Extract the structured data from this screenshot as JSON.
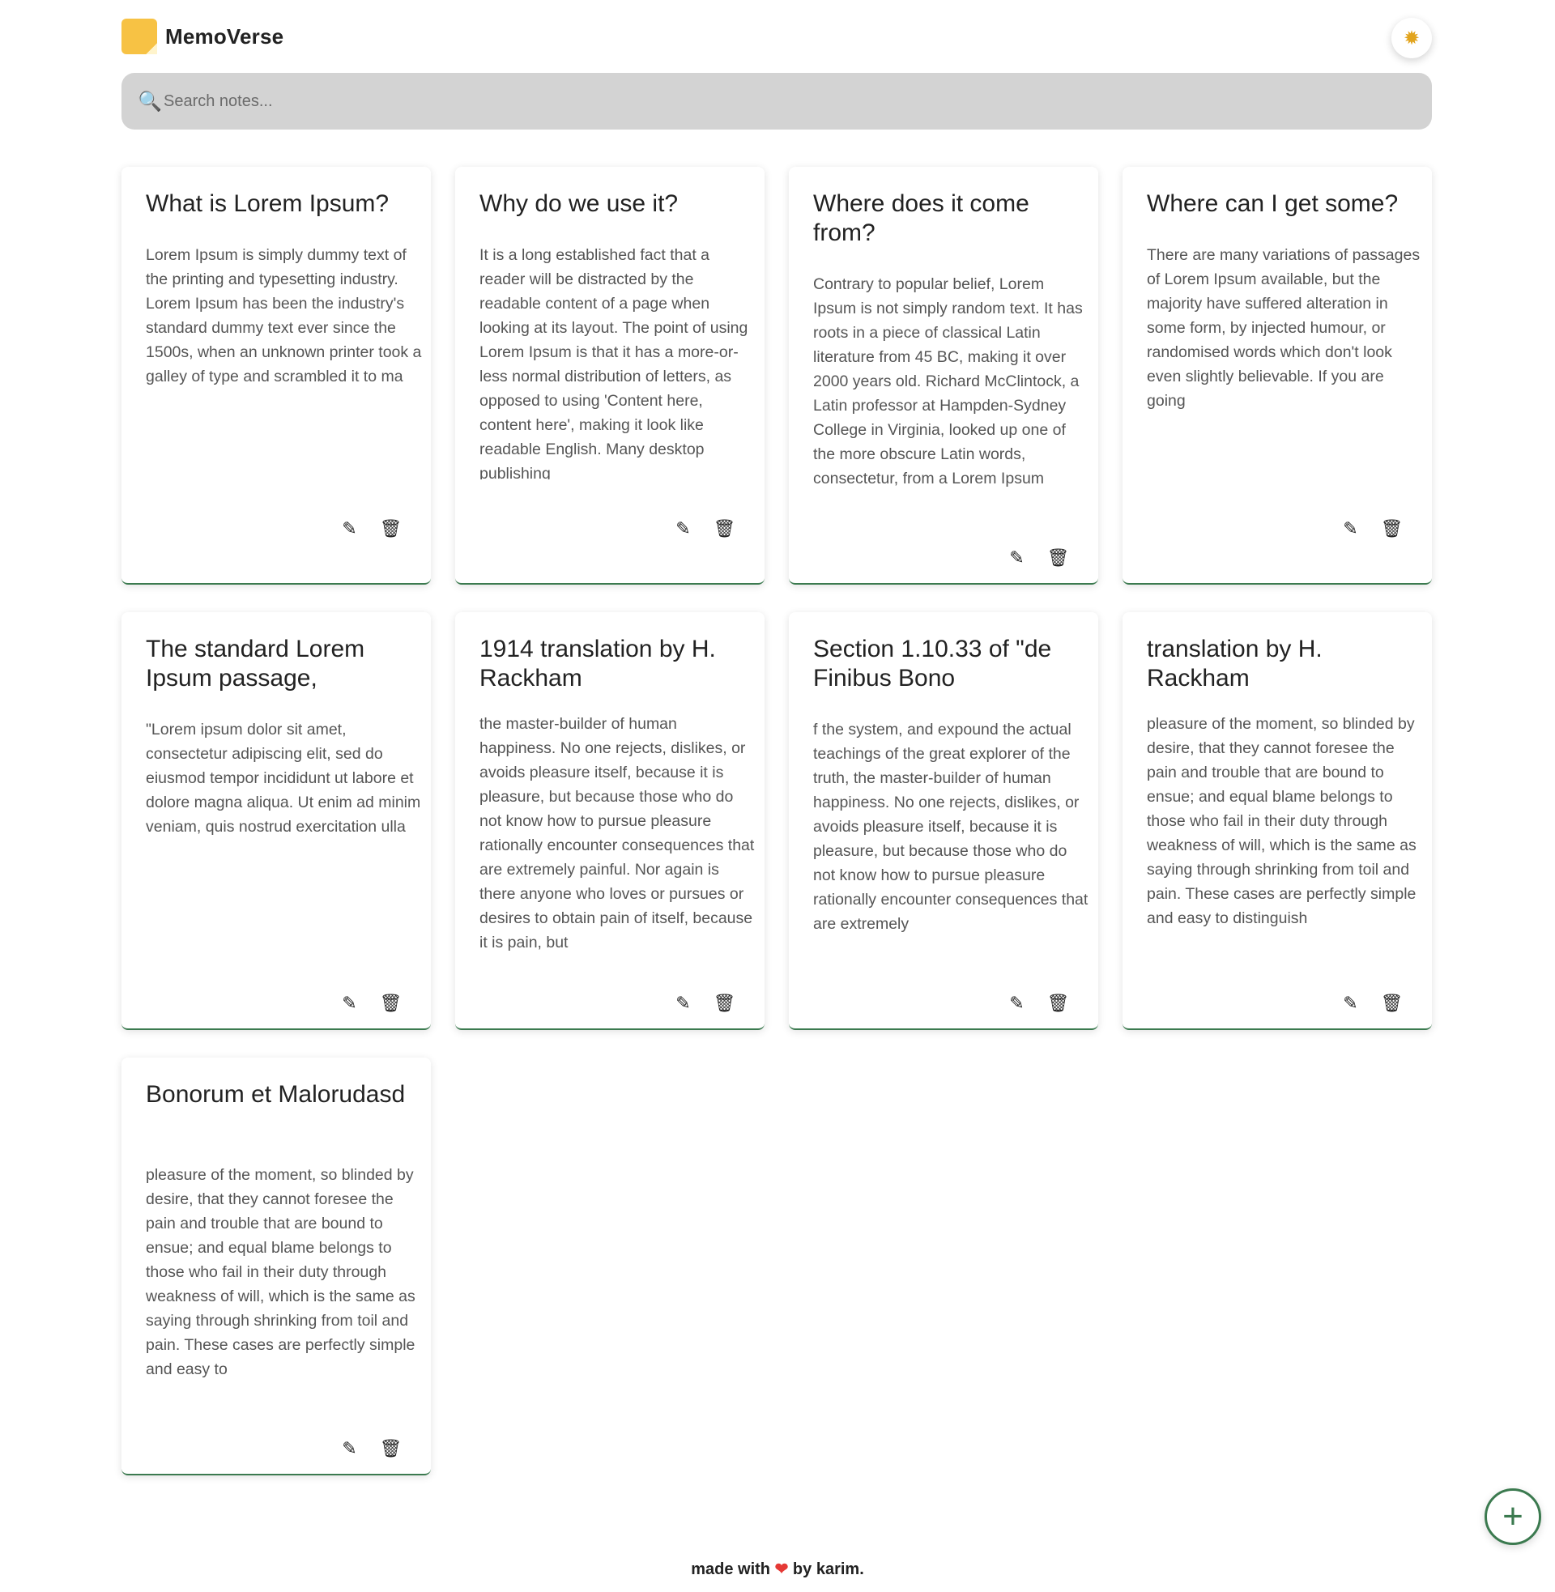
{
  "app": {
    "name": "MemoVerse",
    "theme_toggle_icon": "sun-icon"
  },
  "search": {
    "placeholder": "Search notes...",
    "icon": "search-icon"
  },
  "notes": [
    {
      "title": "What is Lorem Ipsum?",
      "body": "Lorem Ipsum is simply dummy text of the printing and typesetting industry. Lorem Ipsum has been the industry's standard dummy text ever since the 1500s, when an unknown printer took a galley of type and scrambled it to ma"
    },
    {
      "title": "Why do we use it?",
      "body": "It is a long established fact that a reader will be distracted by the readable content of a page when looking at its layout. The point of using Lorem Ipsum is that it has a more-or-less normal distribution of letters, as opposed to using 'Content here, content here', making it look like readable English. Many desktop publishing"
    },
    {
      "title": "Where does it come from?",
      "body": "Contrary to popular belief, Lorem Ipsum is not simply random text. It has roots in a piece of classical Latin literature from 45 BC, making it over 2000 years old. Richard McClintock, a Latin professor at Hampden-Sydney College in Virginia, looked up one of the more obscure Latin words, consectetur, from a Lorem Ipsum"
    },
    {
      "title": "Where can I get some?",
      "body": "There are many variations of passages of Lorem Ipsum available, but the majority have suffered alteration in some form, by injected humour, or randomised words which don't look even slightly believable. If you are going"
    },
    {
      "title": "The standard Lorem Ipsum passage,",
      "body": "\"Lorem ipsum dolor sit amet, consectetur adipiscing elit, sed do eiusmod tempor incididunt ut labore et dolore magna aliqua. Ut enim ad minim veniam, quis nostrud exercitation ulla"
    },
    {
      "title": "1914 translation by H. Rackham",
      "body": "the master-builder of human happiness. No one rejects, dislikes, or avoids pleasure itself, because it is pleasure, but because those who do not know how to pursue pleasure rationally encounter consequences that are extremely painful. Nor again is there anyone who loves or pursues or desires to obtain pain of itself, because it is pain, but"
    },
    {
      "title": "Section 1.10.33 of \"de Finibus Bono",
      "body": "f the system, and expound the actual teachings of the great explorer of the truth, the master-builder of human happiness. No one rejects, dislikes, or avoids pleasure itself, because it is pleasure, but because those who do not know how to pursue pleasure rationally encounter consequences that are extremely"
    },
    {
      "title": "translation by H. Rackham",
      "body": "pleasure of the moment, so blinded by desire, that they cannot foresee the pain and trouble that are bound to ensue; and equal blame belongs to those who fail in their duty through weakness of will, which is the same as saying through shrinking from toil and pain. These cases are perfectly simple and easy to distinguish"
    },
    {
      "title": "Bonorum et Malorudasd",
      "body": "pleasure of the moment, so blinded by desire, that they cannot foresee the pain and trouble that are bound to ensue; and equal blame belongs to those who fail in their duty through weakness of will, which is the same as saying through shrinking from toil and pain. These cases are perfectly simple and easy to"
    }
  ],
  "actions": {
    "edit_icon": "edit-icon",
    "delete_icon": "trash-icon"
  },
  "fab": {
    "icon": "plus-icon"
  },
  "footer": {
    "prefix": "made with",
    "heart": "❤",
    "suffix": "by karim."
  },
  "colors": {
    "accent": "#3b7a4f",
    "logo": "#f7c244",
    "search_bg": "#d3d3d3",
    "heart": "#e53935"
  }
}
